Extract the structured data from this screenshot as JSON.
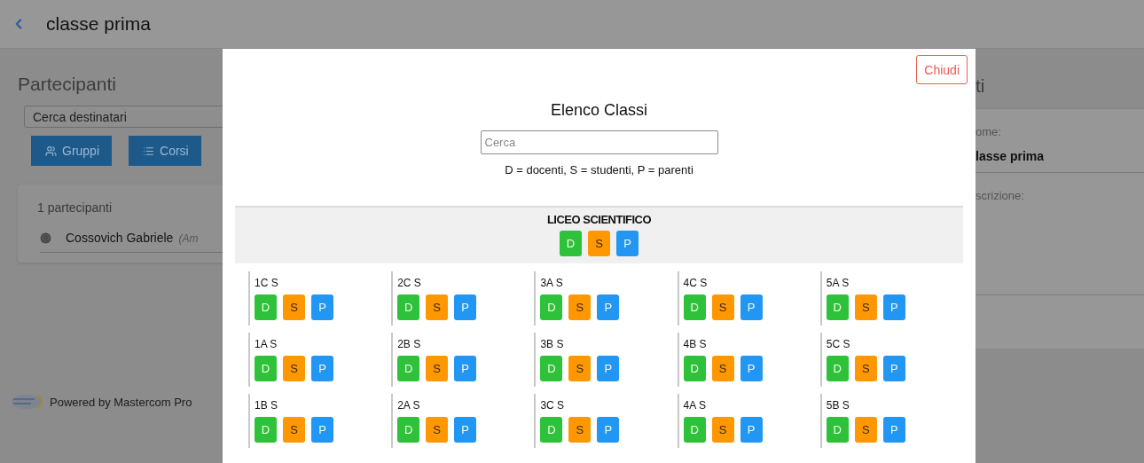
{
  "header": {
    "title": "classe prima"
  },
  "participants_panel": {
    "title": "Partecipanti",
    "search": {
      "placeholder": "Cerca destinatari"
    },
    "buttons": [
      {
        "kind": "groups",
        "label": "Gruppi"
      },
      {
        "kind": "courses",
        "label": "Corsi"
      }
    ],
    "count": "1 partecipanti",
    "participants": [
      {
        "name": "Cossovich Gabriele",
        "role": "(Am"
      }
    ]
  },
  "footer": {
    "text": "Powered by Mastercom Pro"
  },
  "details_panel": {
    "title": "ti",
    "fields": [
      {
        "label": "ome:",
        "value": "lasse prima"
      },
      {
        "label": "scrizione:"
      }
    ]
  },
  "modal": {
    "close": "Chiudi",
    "title": "Elenco Classi",
    "search": {
      "placeholder": "Cerca"
    },
    "legend": "D = docenti, S = studenti, P = parenti",
    "school": {
      "name": "LICEO SCIENTIFICO",
      "buttons": [
        {
          "label": "D",
          "color": "#2ec23a"
        },
        {
          "label": "S",
          "color": "#ff9800"
        },
        {
          "label": "P",
          "color": "#2196f3"
        }
      ]
    },
    "classes": [
      {
        "name": "1C S",
        "buttons": [
          {
            "label": "D",
            "color": "#2ec23a"
          },
          {
            "label": "S",
            "color": "#ff9800"
          },
          {
            "label": "P",
            "color": "#2196f3"
          }
        ]
      },
      {
        "name": "2C S",
        "buttons": [
          {
            "label": "D",
            "color": "#2ec23a"
          },
          {
            "label": "S",
            "color": "#ff9800"
          },
          {
            "label": "P",
            "color": "#2196f3"
          }
        ]
      },
      {
        "name": "3A S",
        "buttons": [
          {
            "label": "D",
            "color": "#2ec23a"
          },
          {
            "label": "S",
            "color": "#ff9800"
          },
          {
            "label": "P",
            "color": "#2196f3"
          }
        ]
      },
      {
        "name": "4C S",
        "buttons": [
          {
            "label": "D",
            "color": "#2ec23a"
          },
          {
            "label": "S",
            "color": "#ff9800"
          },
          {
            "label": "P",
            "color": "#2196f3"
          }
        ]
      },
      {
        "name": "5A S",
        "buttons": [
          {
            "label": "D",
            "color": "#2ec23a"
          },
          {
            "label": "S",
            "color": "#ff9800"
          },
          {
            "label": "P",
            "color": "#2196f3"
          }
        ]
      },
      {
        "name": "1A S",
        "buttons": [
          {
            "label": "D",
            "color": "#2ec23a"
          },
          {
            "label": "S",
            "color": "#ff9800"
          },
          {
            "label": "P",
            "color": "#2196f3"
          }
        ]
      },
      {
        "name": "2B S",
        "buttons": [
          {
            "label": "D",
            "color": "#2ec23a"
          },
          {
            "label": "S",
            "color": "#ff9800"
          },
          {
            "label": "P",
            "color": "#2196f3"
          }
        ]
      },
      {
        "name": "3B S",
        "buttons": [
          {
            "label": "D",
            "color": "#2ec23a"
          },
          {
            "label": "S",
            "color": "#ff9800"
          },
          {
            "label": "P",
            "color": "#2196f3"
          }
        ]
      },
      {
        "name": "4B S",
        "buttons": [
          {
            "label": "D",
            "color": "#2ec23a"
          },
          {
            "label": "S",
            "color": "#ff9800"
          },
          {
            "label": "P",
            "color": "#2196f3"
          }
        ]
      },
      {
        "name": "5C S",
        "buttons": [
          {
            "label": "D",
            "color": "#2ec23a"
          },
          {
            "label": "S",
            "color": "#ff9800"
          },
          {
            "label": "P",
            "color": "#2196f3"
          }
        ]
      },
      {
        "name": "1B S",
        "buttons": [
          {
            "label": "D",
            "color": "#2ec23a"
          },
          {
            "label": "S",
            "color": "#ff9800"
          },
          {
            "label": "P",
            "color": "#2196f3"
          }
        ]
      },
      {
        "name": "2A S",
        "buttons": [
          {
            "label": "D",
            "color": "#2ec23a"
          },
          {
            "label": "S",
            "color": "#ff9800"
          },
          {
            "label": "P",
            "color": "#2196f3"
          }
        ]
      },
      {
        "name": "3C S",
        "buttons": [
          {
            "label": "D",
            "color": "#2ec23a"
          },
          {
            "label": "S",
            "color": "#ff9800"
          },
          {
            "label": "P",
            "color": "#2196f3"
          }
        ]
      },
      {
        "name": "4A S",
        "buttons": [
          {
            "label": "D",
            "color": "#2ec23a"
          },
          {
            "label": "S",
            "color": "#ff9800"
          },
          {
            "label": "P",
            "color": "#2196f3"
          }
        ]
      },
      {
        "name": "5B S",
        "buttons": [
          {
            "label": "D",
            "color": "#2ec23a"
          },
          {
            "label": "S",
            "color": "#ff9800"
          },
          {
            "label": "P",
            "color": "#2196f3"
          }
        ]
      }
    ]
  }
}
